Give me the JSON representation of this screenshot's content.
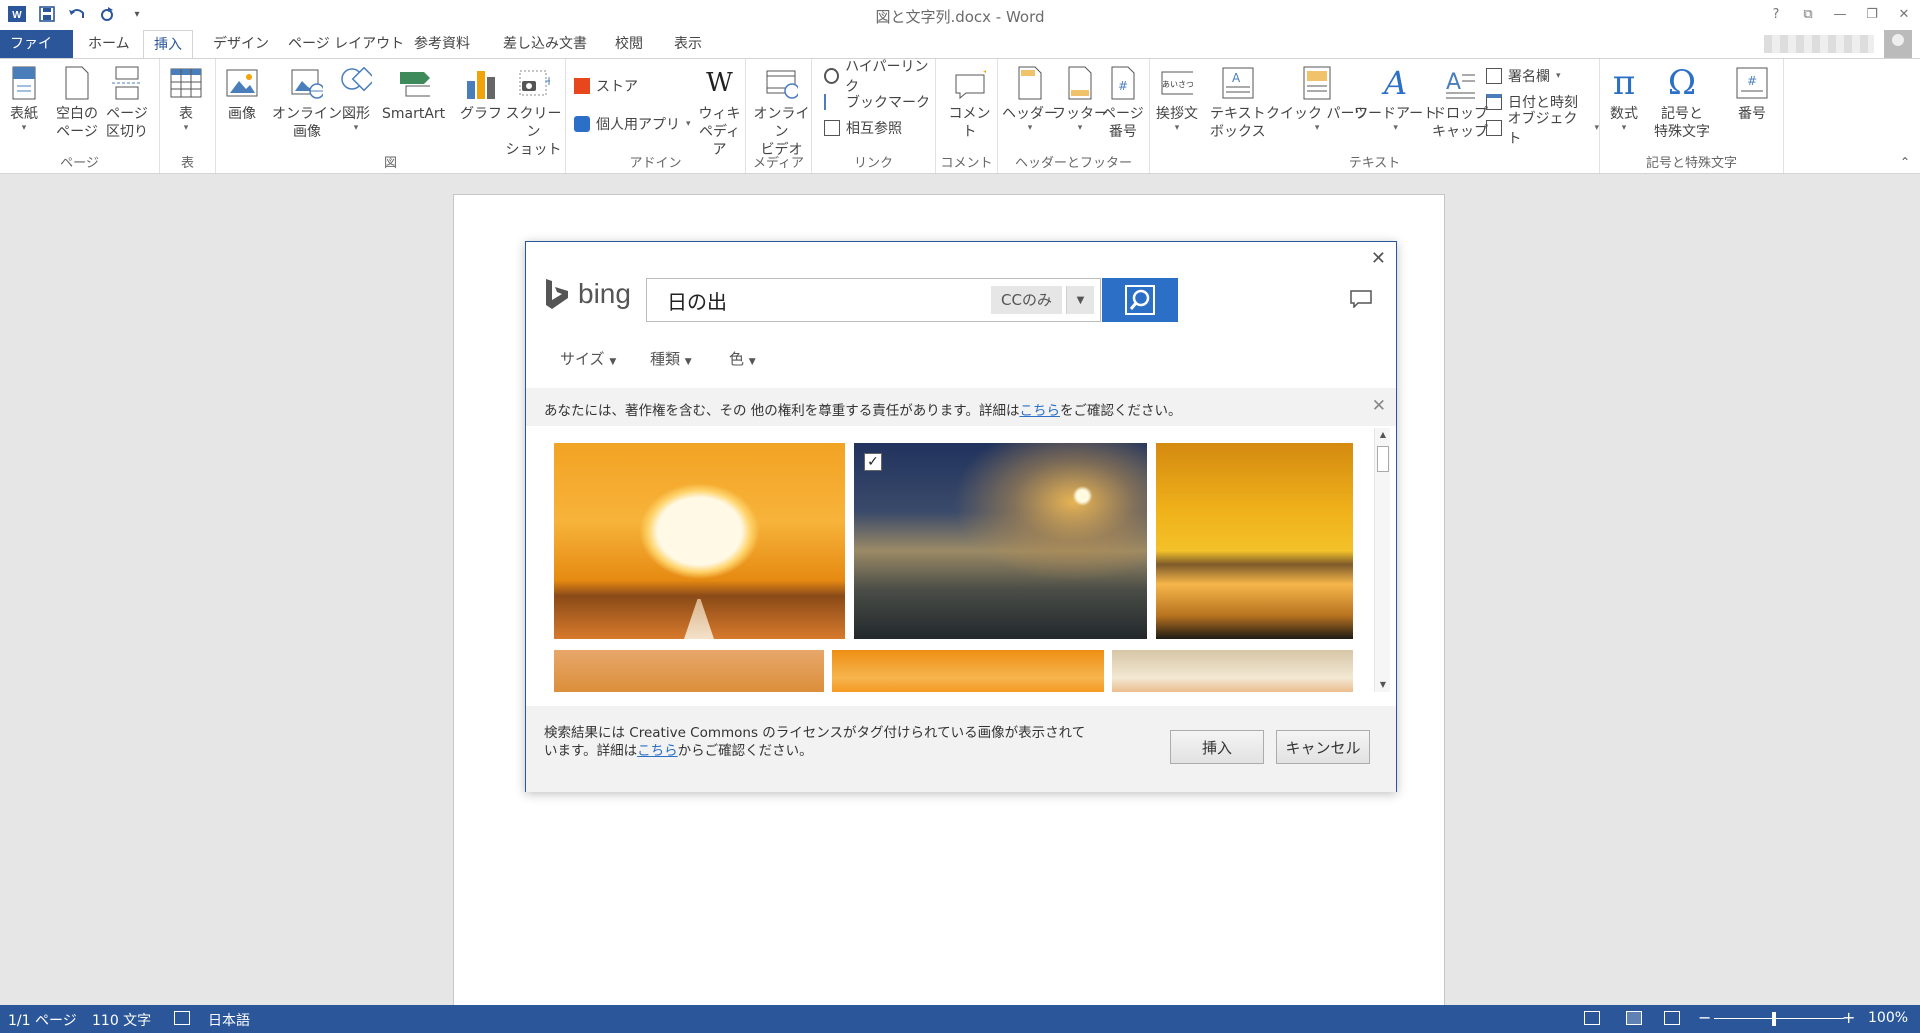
{
  "window": {
    "title": "図と文字列.docx - Word",
    "controls": [
      "?",
      "⧉",
      "—",
      "❐",
      "✕"
    ]
  },
  "qat": {
    "word_icon": "W",
    "save_icon": "save-icon",
    "undo_icon": "undo-icon",
    "redo_icon": "redo-icon",
    "customize": "▾"
  },
  "tabs": [
    "ファイル",
    "ホーム",
    "挿入",
    "デザイン",
    "ページ レイアウト",
    "参考資料",
    "差し込み文書",
    "校閲",
    "表示"
  ],
  "ribbon": {
    "groups": {
      "pages": "ページ",
      "table": "表",
      "illustrations": "図",
      "addins": "アドイン",
      "media": "メディア",
      "links": "リンク",
      "comments": "コメント",
      "header_footer": "ヘッダーとフッター",
      "text": "テキスト",
      "symbols": "記号と特殊文字"
    },
    "buttons": {
      "cover": "表紙",
      "blank_page_1": "空白の",
      "blank_page_2": "ページ",
      "page_break_1": "ページ",
      "page_break_2": "区切り",
      "table": "表",
      "pictures": "画像",
      "online_pictures_1": "オンライン",
      "online_pictures_2": "画像",
      "shapes": "図形",
      "smartart": "SmartArt",
      "chart": "グラフ",
      "screenshot_1": "スクリーン",
      "screenshot_2": "ショット",
      "store": "ストア",
      "my_apps": "個人用アプリ",
      "wikipedia_1": "ウィキ",
      "wikipedia_2": "ペディア",
      "online_video_1": "オンライン",
      "online_video_2": "ビデオ",
      "hyperlink": "ハイパーリンク",
      "bookmark": "ブックマーク",
      "cross_ref": "相互参照",
      "comment": "コメント",
      "header": "ヘッダー",
      "footer": "フッター",
      "page_number_1": "ページ",
      "page_number_2": "番号",
      "greeting": "挨拶文",
      "textbox_1": "テキスト",
      "textbox_2": "ボックス",
      "quick_parts": "クイック パーツ",
      "wordart": "ワードアート",
      "dropcap_1": "ドロップ",
      "dropcap_2": "キャップ",
      "signature": "署名欄",
      "datetime": "日付と時刻",
      "object": "オブジェクト",
      "equation": "数式",
      "symbol_1": "記号と",
      "symbol_2": "特殊文字",
      "number": "番号"
    }
  },
  "dialog": {
    "brand": "bing",
    "search_value": "日の出",
    "cc_filter": "CCのみ",
    "filters": [
      "サイズ",
      "種類",
      "色"
    ],
    "notice_prefix": "あなたには、著作権を含む、その 他の権利を尊重する責任があります。詳細は",
    "notice_link": "こちら",
    "notice_suffix": "をご確認ください。",
    "footer_line1": "検索結果には Creative Commons のライセンスがタグ付けられている画像が表示されて",
    "footer_line2_prefix": "います。詳細は",
    "footer_link": "こちら",
    "footer_line2_suffix": "からご確認ください。",
    "insert": "挿入",
    "cancel": "キャンセル",
    "close": "✕",
    "selected_check": "✓"
  },
  "status": {
    "page": "1/1 ページ",
    "words": "110 文字",
    "language": "日本語",
    "zoom": "100%",
    "zoom_minus": "−",
    "zoom_plus": "+"
  }
}
